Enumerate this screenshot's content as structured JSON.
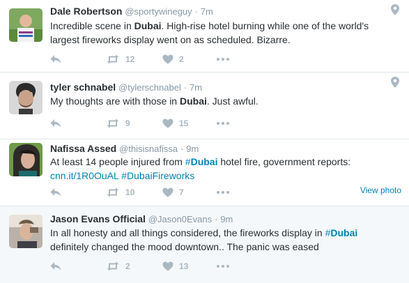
{
  "tweets": [
    {
      "fullname": "Dale Robertson",
      "username": "@sportywineguy",
      "dot": "·",
      "time": "7m",
      "text_parts": [
        "Incredible scene in ",
        "Dubai",
        ". High-rise hotel burning while one of the world's largest fireworks display went on as scheduled. Bizarre."
      ],
      "retweets": "12",
      "likes": "2",
      "has_geo": true
    },
    {
      "fullname": "tyler schnabel",
      "username": "@tylerschnabel",
      "dot": "·",
      "time": "7m",
      "text_parts": [
        "My thoughts are with those in ",
        "Dubai",
        ". Just awful."
      ],
      "retweets": "9",
      "likes": "15",
      "has_geo": true
    },
    {
      "fullname": "Nafissa Assed",
      "username": "@thisisnafissa",
      "dot": "·",
      "time": "9m",
      "text_parts": [
        "At least 14 people injured from ",
        "#",
        "Dubai",
        " hotel fire, government reports: "
      ],
      "link": "cnn.it/1R0OuAL",
      "hashtag2": "#DubaiFireworks",
      "retweets": "10",
      "likes": "7",
      "view_photo": "View photo"
    },
    {
      "fullname": "Jason Evans Official",
      "username": "@Jason0Evans",
      "dot": "·",
      "time": "9m",
      "text_parts": [
        "In all honesty and all things considered, the fireworks display in ",
        "#",
        "Dubai",
        " definitely changed the mood downtown.. The panic was eased"
      ],
      "retweets": "2",
      "likes": "13"
    }
  ],
  "icons": {
    "reply": "reply-icon",
    "retweet": "retweet-icon",
    "like": "heart-icon",
    "more": "more-icon",
    "geo": "location-pin-icon"
  },
  "colors": {
    "link": "#0084b4",
    "muted": "#8899a6",
    "icon": "#aab8c2",
    "divider": "#e1e8ed",
    "highlight_bg": "#f5f8fa"
  }
}
